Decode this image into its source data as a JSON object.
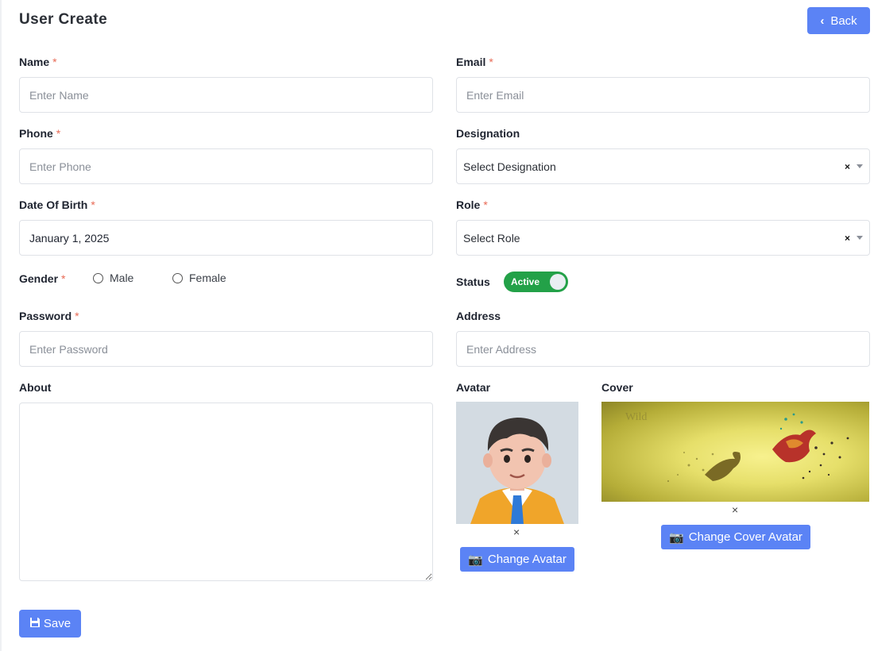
{
  "header": {
    "title": "User Create",
    "back_label": "Back"
  },
  "form": {
    "name": {
      "label": "Name",
      "placeholder": "Enter Name",
      "required": "*"
    },
    "email": {
      "label": "Email",
      "placeholder": "Enter Email",
      "required": "*"
    },
    "phone": {
      "label": "Phone",
      "placeholder": "Enter Phone",
      "required": "*"
    },
    "designation": {
      "label": "Designation",
      "value": "Select Designation",
      "clear": "×"
    },
    "dob": {
      "label": "Date Of Birth",
      "value": "January 1, 2025",
      "required": "*"
    },
    "role": {
      "label": "Role",
      "value": "Select Role",
      "required": "*",
      "clear": "×"
    },
    "gender": {
      "label": "Gender",
      "required": "*",
      "options": [
        "Male",
        "Female"
      ]
    },
    "status": {
      "label": "Status",
      "toggle_label": "Active"
    },
    "password": {
      "label": "Password",
      "placeholder": "Enter Password",
      "required": "*"
    },
    "address": {
      "label": "Address",
      "placeholder": "Enter Address"
    },
    "about": {
      "label": "About"
    },
    "avatar": {
      "label": "Avatar",
      "remove": "×",
      "button": "Change Avatar"
    },
    "cover": {
      "label": "Cover",
      "remove": "×",
      "button": "Change Cover Avatar",
      "image_text": "Wild"
    }
  },
  "footer": {
    "save_label": "Save"
  },
  "colors": {
    "primary": "#5b83f5",
    "required": "#e86a55",
    "active": "#23a148"
  }
}
